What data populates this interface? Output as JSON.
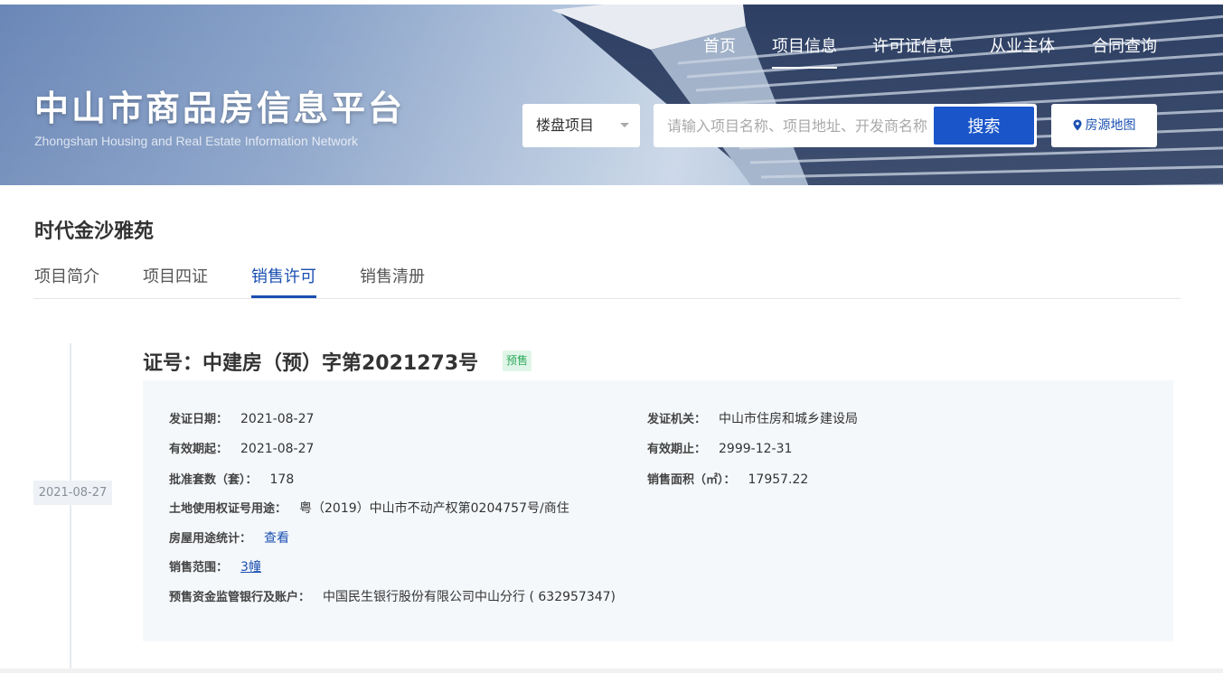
{
  "brand": {
    "title": "中山市商品房信息平台",
    "subtitle": "Zhongshan Housing and Real Estate Information Network"
  },
  "nav": {
    "items": [
      "首页",
      "项目信息",
      "许可证信息",
      "从业主体",
      "合同查询"
    ],
    "active": "项目信息"
  },
  "search": {
    "category": "楼盘项目",
    "placeholder": "请输入项目名称、项目地址、开发商名称",
    "button_label": "搜索",
    "map_label": "房源地图"
  },
  "project": {
    "name": "时代金沙雅苑",
    "tabs": [
      "项目简介",
      "项目四证",
      "销售许可",
      "销售清册"
    ],
    "active_tab": "销售许可"
  },
  "permit": {
    "date_badge": "2021-08-27",
    "title": "证号：中建房（预）字第2021273号",
    "tag": "预售",
    "issue_date_label": "发证日期：",
    "issue_date": "2021-08-27",
    "issuer_label": "发证机关：",
    "issuer": "中山市住房和城乡建设局",
    "valid_from_label": "有效期起：",
    "valid_from": "2021-08-27",
    "valid_to_label": "有效期止：",
    "valid_to": "2999-12-31",
    "units_label": "批准套数（套）：",
    "units": "178",
    "area_label": "销售面积（㎡）：",
    "area": "17957.22",
    "land_cert_label": "土地使用权证号用途：",
    "land_cert": "粤（2019）中山市不动产权第0204757号/商住",
    "usage_stats_label": "房屋用途统计：",
    "usage_stats_link": "查看",
    "sales_scope_label": "销售范围：",
    "sales_scope_link": "3幢",
    "escrow_label": "预售资金监管银行及账户：",
    "escrow": "中国民生银行股份有限公司中山分行 ( 632957347)"
  },
  "colors": {
    "primary": "#1a56c9",
    "link": "#1a4fb0",
    "tag_bg": "#dff5e7",
    "tag_text": "#2eaa5c",
    "panel_bg": "#f5f8fb"
  }
}
